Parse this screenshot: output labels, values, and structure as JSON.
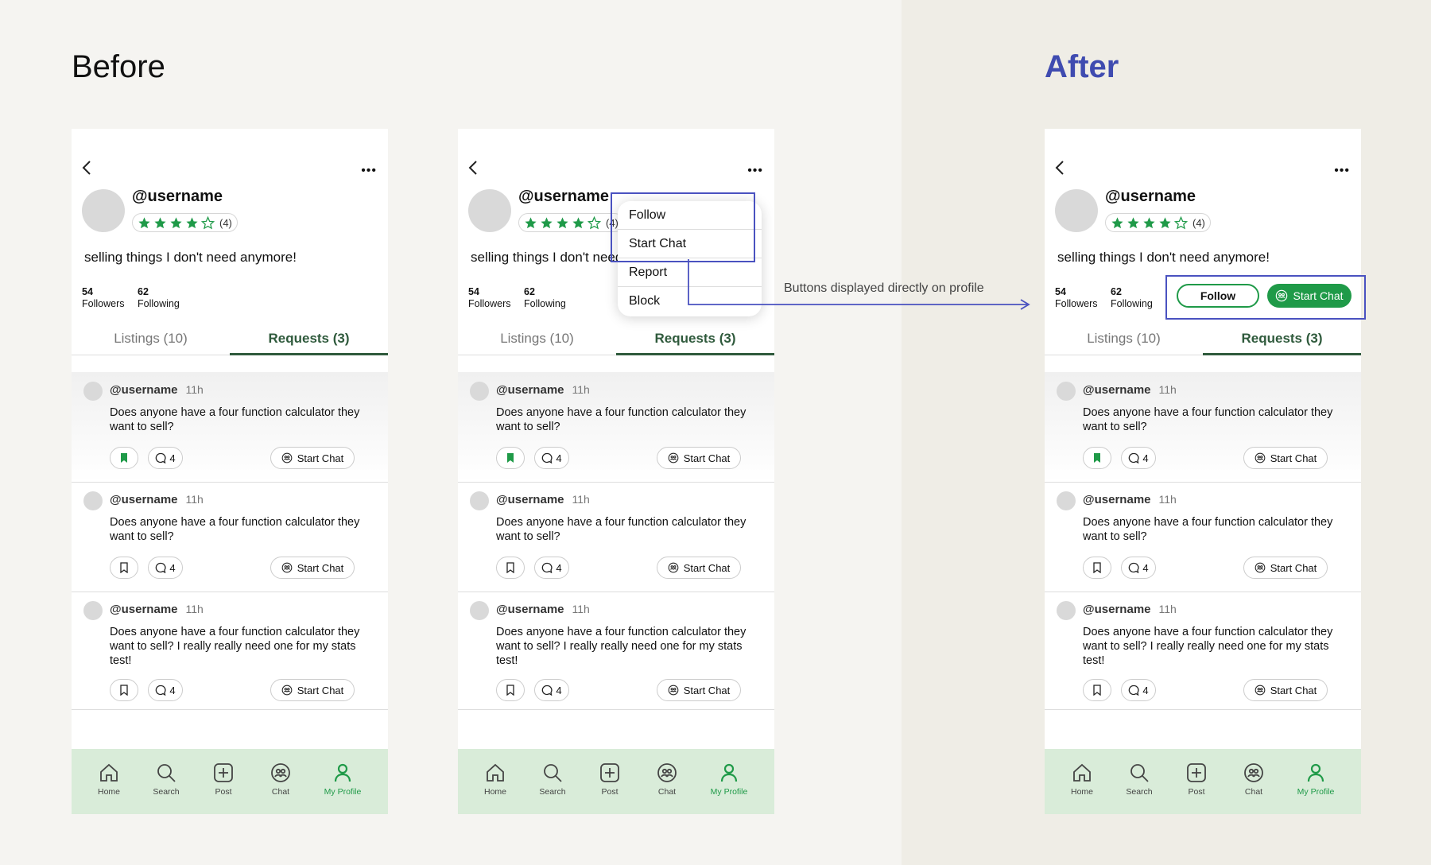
{
  "headings": {
    "before": "Before",
    "after": "After"
  },
  "profile": {
    "username": "@username",
    "rating_count": "(4)",
    "bio": "selling things I don't need anymore!",
    "followers_count": "54",
    "followers_label": "Followers",
    "following_count": "62",
    "following_label": "Following"
  },
  "tabs": {
    "listings": "Listings (10)",
    "requests": "Requests (3)"
  },
  "posts": [
    {
      "user": "@username",
      "time": "11h",
      "text": "Does anyone have a four function calculator they want to sell?",
      "comments": "4",
      "chat": "Start Chat",
      "saved": true
    },
    {
      "user": "@username",
      "time": "11h",
      "text": "Does anyone have a four function calculator they want to sell?",
      "comments": "4",
      "chat": "Start Chat",
      "saved": false
    },
    {
      "user": "@username",
      "time": "11h",
      "text": "Does anyone have a four function calculator they want to sell? I really really need one for my stats test!",
      "comments": "4",
      "chat": "Start Chat",
      "saved": false
    }
  ],
  "menu": {
    "follow": "Follow",
    "start_chat": "Start Chat",
    "report": "Report",
    "block": "Block"
  },
  "annotation": "Buttons displayed directly on profile",
  "after_buttons": {
    "follow": "Follow",
    "start_chat": "Start Chat"
  },
  "nav": {
    "home": "Home",
    "search": "Search",
    "post": "Post",
    "chat": "Chat",
    "profile": "My Profile"
  },
  "colors": {
    "accent_green": "#1f9a48",
    "highlight_blue": "#4a52c0",
    "after_heading": "#3f4bb0",
    "nav_bg": "#d9ecd9"
  }
}
